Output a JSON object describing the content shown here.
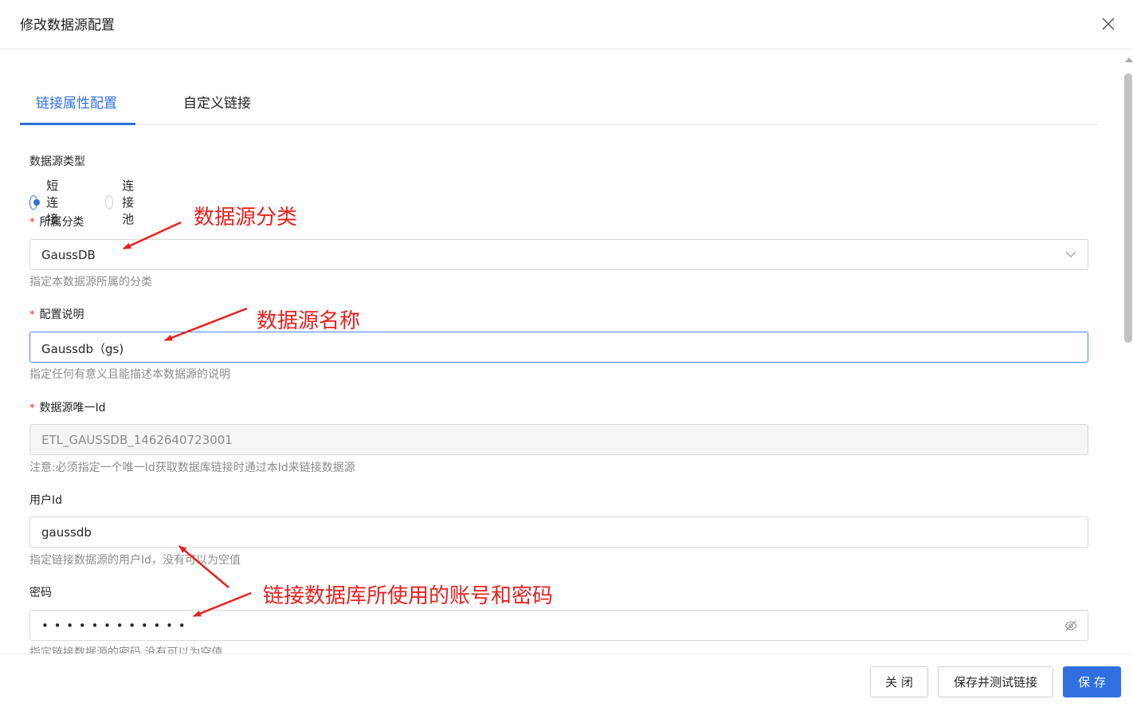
{
  "modal": {
    "title": "修改数据源配置"
  },
  "tabs": [
    {
      "label": "链接属性配置",
      "active": true
    },
    {
      "label": "自定义链接",
      "active": false
    }
  ],
  "form": {
    "datasource_type": {
      "label": "数据源类型",
      "options": [
        {
          "label": "短连接",
          "checked": true
        },
        {
          "label": "连接池",
          "checked": false
        }
      ]
    },
    "category": {
      "required_mark": "*",
      "label": "所属分类",
      "value": "GaussDB",
      "help": "指定本数据源所属的分类"
    },
    "description": {
      "required_mark": "*",
      "label": "配置说明",
      "value": "Gaussdb（gs)",
      "help": "指定任何有意义且能描述本数据源的说明"
    },
    "unique_id": {
      "required_mark": "*",
      "label": "数据源唯一Id",
      "value": "ETL_GAUSSDB_1462640723001",
      "help": "注意:必须指定一个唯一Id获取数据库链接时通过本Id来链接数据源"
    },
    "user_id": {
      "label": "用户Id",
      "value": "gaussdb",
      "help": "指定链接数据源的用户Id，没有可以为空值"
    },
    "password": {
      "label": "密码",
      "value": "• • • • • • • • • • • •",
      "help": "指定链接数据源的密码,没有可以为空值"
    }
  },
  "annotations": {
    "category": "数据源分类",
    "name": "数据源名称",
    "account": "链接数据库所使用的账号和密码"
  },
  "footer": {
    "close_label": "关 闭",
    "save_test_label": "保存并测试链接",
    "save_label": "保 存"
  },
  "colors": {
    "accent": "#2f6fe0",
    "required": "#f5222d",
    "annotation": "#e8201e"
  }
}
